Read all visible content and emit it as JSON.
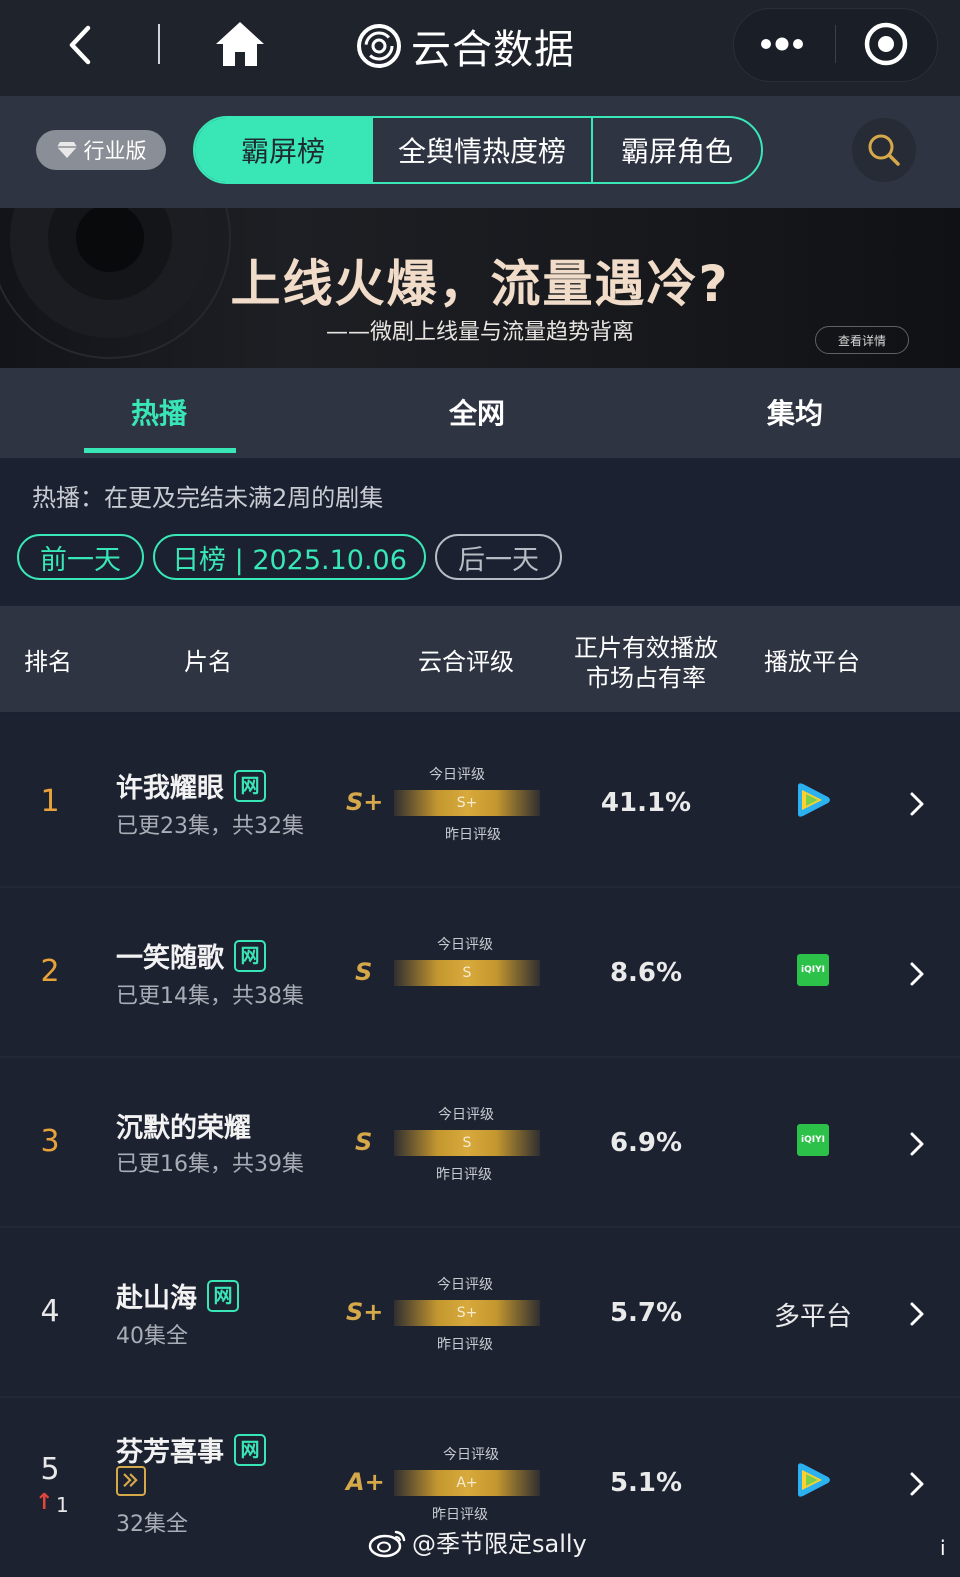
{
  "header": {
    "title": "云合数据"
  },
  "nav": {
    "badge": "行业版",
    "tabs": [
      {
        "label": "霸屏榜",
        "active": true
      },
      {
        "label": "全舆情热度榜",
        "active": false
      },
      {
        "label": "霸屏角色",
        "active": false
      }
    ]
  },
  "banner": {
    "title": "上线火爆，流量遇冷?",
    "subtitle": "——微剧上线量与流量趋势背离",
    "more": "查看详情"
  },
  "subtabs": [
    {
      "label": "热播",
      "active": true
    },
    {
      "label": "全网",
      "active": false
    },
    {
      "label": "集均",
      "active": false
    }
  ],
  "info": "热播：在更及完结未满2周的剧集",
  "date_controls": {
    "prev": "前一天",
    "current": "日榜 | 2025.10.06",
    "next": "后一天"
  },
  "table": {
    "headers": {
      "rank": "排名",
      "title": "片名",
      "rating": "云合评级",
      "share_line1": "正片有效播放",
      "share_line2": "市场占有率",
      "platform": "播放平台"
    },
    "gauge_today": "今日评级",
    "gauge_yesterday": "昨日评级",
    "rows": [
      {
        "rank": "1",
        "title": "许我耀眼",
        "tag": "网",
        "episodes": "已更23集，共32集",
        "grade": "S+",
        "gauge": "S+",
        "share": "41.1%",
        "platform_icon": "tencent-video-icon"
      },
      {
        "rank": "2",
        "title": "一笑随歌",
        "tag": "网",
        "episodes": "已更14集，共38集",
        "grade": "S",
        "gauge": "S",
        "share": "8.6%",
        "platform_icon": "iqiyi-icon",
        "platform_text": "iQIYI"
      },
      {
        "rank": "3",
        "title": "沉默的荣耀",
        "episodes": "已更16集，共39集",
        "grade": "S",
        "gauge": "S",
        "share": "6.9%",
        "platform_icon": "iqiyi-icon",
        "platform_text": "iQIYI"
      },
      {
        "rank": "4",
        "title": "赴山海",
        "tag": "网",
        "episodes": "40集全",
        "grade": "S+",
        "gauge": "S+",
        "share": "5.7%",
        "platform_text": "多平台"
      },
      {
        "rank": "5",
        "rank_change": "1",
        "title": "芬芳喜事",
        "tag": "网",
        "episodes": "32集全",
        "grade": "A+",
        "gauge": "A+",
        "share": "5.1%",
        "platform_icon": "tencent-video-icon"
      }
    ]
  },
  "watermark": "@季节限定sally",
  "corner": "i",
  "colors": {
    "accent": "#39e6b6",
    "gold": "#d5a84a",
    "rank_top": "#e8a23a",
    "rank_up": "#e0463c"
  }
}
